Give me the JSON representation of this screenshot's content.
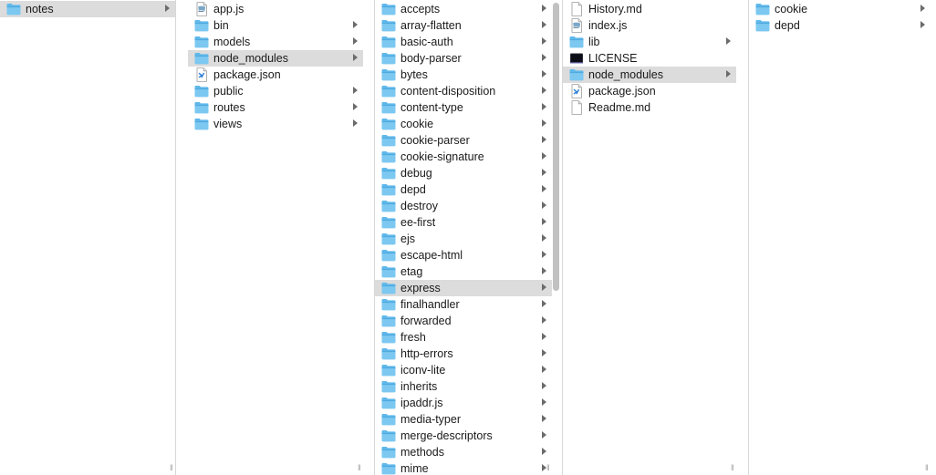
{
  "folder_color": "#5fb8ea",
  "columns": [
    {
      "items": [
        {
          "label": "notes",
          "type": "folder",
          "selected": true
        }
      ]
    },
    {
      "items": [
        {
          "label": "app.js",
          "type": "js-file"
        },
        {
          "label": "bin",
          "type": "folder"
        },
        {
          "label": "models",
          "type": "folder"
        },
        {
          "label": "node_modules",
          "type": "folder",
          "selected": true
        },
        {
          "label": "package.json",
          "type": "json-file"
        },
        {
          "label": "public",
          "type": "folder"
        },
        {
          "label": "routes",
          "type": "folder"
        },
        {
          "label": "views",
          "type": "folder"
        }
      ]
    },
    {
      "items": [
        {
          "label": "accepts",
          "type": "folder"
        },
        {
          "label": "array-flatten",
          "type": "folder"
        },
        {
          "label": "basic-auth",
          "type": "folder"
        },
        {
          "label": "body-parser",
          "type": "folder"
        },
        {
          "label": "bytes",
          "type": "folder"
        },
        {
          "label": "content-disposition",
          "type": "folder"
        },
        {
          "label": "content-type",
          "type": "folder"
        },
        {
          "label": "cookie",
          "type": "folder"
        },
        {
          "label": "cookie-parser",
          "type": "folder"
        },
        {
          "label": "cookie-signature",
          "type": "folder"
        },
        {
          "label": "debug",
          "type": "folder"
        },
        {
          "label": "depd",
          "type": "folder"
        },
        {
          "label": "destroy",
          "type": "folder"
        },
        {
          "label": "ee-first",
          "type": "folder"
        },
        {
          "label": "ejs",
          "type": "folder"
        },
        {
          "label": "escape-html",
          "type": "folder"
        },
        {
          "label": "etag",
          "type": "folder"
        },
        {
          "label": "express",
          "type": "folder",
          "selected": true
        },
        {
          "label": "finalhandler",
          "type": "folder"
        },
        {
          "label": "forwarded",
          "type": "folder"
        },
        {
          "label": "fresh",
          "type": "folder"
        },
        {
          "label": "http-errors",
          "type": "folder"
        },
        {
          "label": "iconv-lite",
          "type": "folder"
        },
        {
          "label": "inherits",
          "type": "folder"
        },
        {
          "label": "ipaddr.js",
          "type": "folder"
        },
        {
          "label": "media-typer",
          "type": "folder"
        },
        {
          "label": "merge-descriptors",
          "type": "folder"
        },
        {
          "label": "methods",
          "type": "folder"
        },
        {
          "label": "mime",
          "type": "folder"
        }
      ]
    },
    {
      "items": [
        {
          "label": "History.md",
          "type": "text-file"
        },
        {
          "label": "index.js",
          "type": "js-file"
        },
        {
          "label": "lib",
          "type": "folder"
        },
        {
          "label": "LICENSE",
          "type": "exec-file"
        },
        {
          "label": "node_modules",
          "type": "folder",
          "selected": true
        },
        {
          "label": "package.json",
          "type": "json-file"
        },
        {
          "label": "Readme.md",
          "type": "text-file"
        }
      ]
    },
    {
      "items": [
        {
          "label": "cookie",
          "type": "folder"
        },
        {
          "label": "depd",
          "type": "folder"
        }
      ]
    }
  ]
}
